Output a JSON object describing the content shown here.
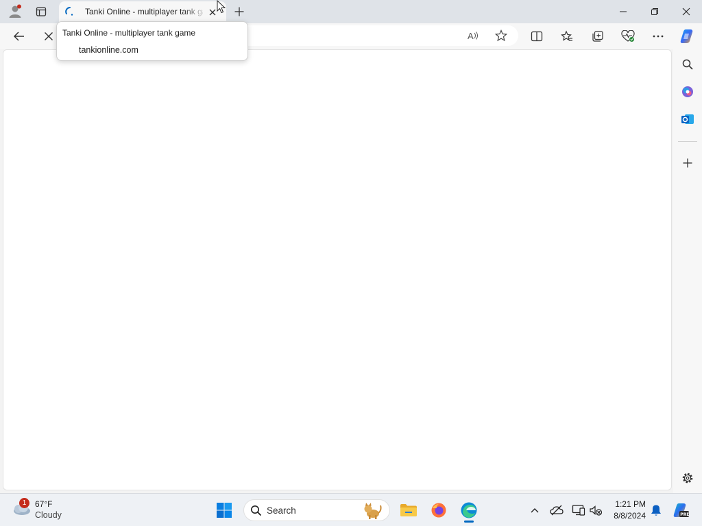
{
  "browser": {
    "tab": {
      "title": "Tanki Online - multiplayer tank game"
    },
    "tooltip": {
      "title": "Tanki Online - multiplayer tank game",
      "url": "tankionline.com"
    },
    "window_controls": [
      "minimize-icon",
      "restore-icon",
      "close-icon"
    ],
    "toolbar_icons": [
      "back-arrow-icon",
      "stop-loading-icon",
      "read-aloud-icon",
      "add-favorite-icon",
      "split-screen-icon",
      "favorites-icon",
      "collections-icon",
      "browser-essentials-icon",
      "more-options-icon",
      "copilot-icon"
    ],
    "sidebar_icons": [
      "search-icon",
      "office-icon",
      "outlook-icon",
      "add-icon",
      "settings-icon"
    ]
  },
  "taskbar": {
    "weather": {
      "temperature": "67°F",
      "condition": "Cloudy",
      "badge": "1"
    },
    "search": {
      "label": "Search"
    },
    "clock": {
      "time": "1:21 PM",
      "date": "8/8/2024"
    },
    "apps": [
      "windows-start-icon",
      "file-explorer-icon",
      "firefox-icon",
      "edge-icon"
    ],
    "tray": [
      "show-hidden-icons-chevron",
      "onedrive-icon",
      "display-icon",
      "network-volume-icon",
      "notification-bell-icon",
      "copilot-pre-icon"
    ]
  },
  "colors": {
    "accent": "#0067c0",
    "titlebar": "#dfe3e8",
    "toolbar": "#f7f7f7",
    "badge": "#c42b1c"
  }
}
